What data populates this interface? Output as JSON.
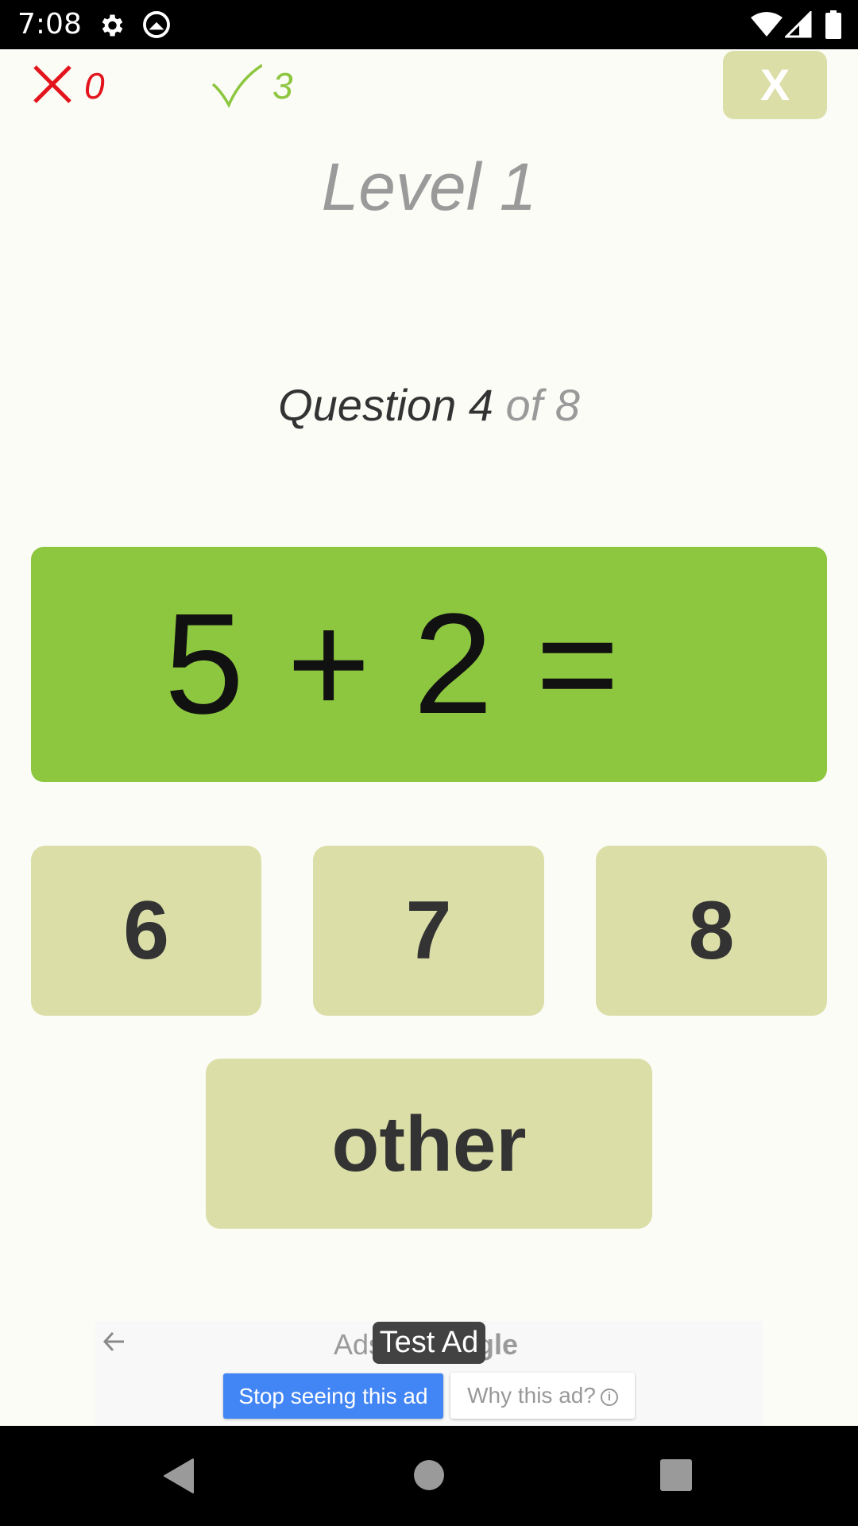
{
  "status_bar": {
    "time": "7:08",
    "icons": [
      "gear-icon",
      "q-logo-icon",
      "wifi-icon",
      "signal-icon",
      "battery-icon"
    ]
  },
  "score": {
    "wrong_count": "0",
    "right_count": "3",
    "wrong_color": "#e3141c",
    "right_color": "#8dc63f"
  },
  "close_button": {
    "label": "X"
  },
  "level": {
    "title": "Level 1"
  },
  "question": {
    "current_label": "Question 4",
    "total_label": "of 8",
    "current": 4,
    "total": 8
  },
  "equation": {
    "text": "5 + 2 ="
  },
  "answers": {
    "options": [
      "6",
      "7",
      "8"
    ],
    "other_label": "other"
  },
  "ad": {
    "by_text_prefix": "Ads",
    "by_text_suffix": "gle",
    "test_badge": "Test Ad",
    "stop_label": "Stop seeing this ad",
    "why_label": "Why this ad?",
    "info_glyph": "i"
  },
  "colors": {
    "background": "#fbfcf6",
    "equation_bg": "#8dc63f",
    "answer_bg": "#dcdea8",
    "ad_blue": "#4285f4"
  }
}
